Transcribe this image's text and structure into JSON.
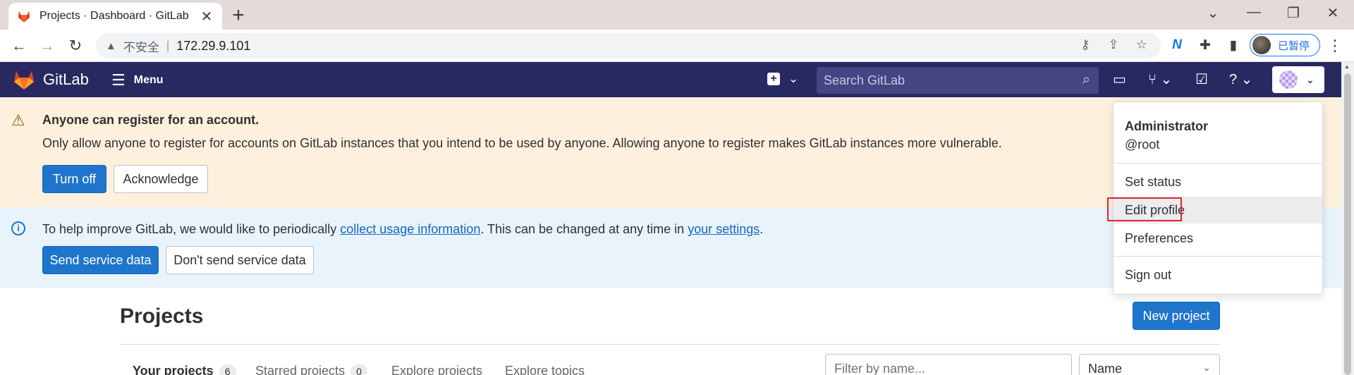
{
  "browser": {
    "tab_title": "Projects · Dashboard · GitLab",
    "insecure_label": "不安全",
    "separator": "|",
    "url": "172.29.9.101",
    "profile_label": "已暂停"
  },
  "header": {
    "brand": "GitLab",
    "menu_label": "Menu",
    "search_placeholder": "Search GitLab",
    "bg_color": "#292961"
  },
  "warning_banner": {
    "title": "Anyone can register for an account.",
    "body": "Only allow anyone to register for accounts on GitLab instances that you intend to be used by anyone. Allowing anyone to register makes GitLab instances more vulnerable.",
    "primary_label": "Turn off",
    "secondary_label": "Acknowledge"
  },
  "info_banner": {
    "text_before": "To help improve GitLab, we would like to periodically ",
    "link1": "collect usage information",
    "text_middle": ". This can be changed at any time in ",
    "link2": "your settings",
    "text_after": ".",
    "primary_label": "Send service data",
    "secondary_label": "Don't send service data"
  },
  "page": {
    "title": "Projects",
    "new_project_label": "New project",
    "tabs": [
      {
        "label": "Your projects",
        "count": "6"
      },
      {
        "label": "Starred projects",
        "count": "0"
      },
      {
        "label": "Explore projects"
      },
      {
        "label": "Explore topics"
      }
    ],
    "filter_placeholder": "Filter by name...",
    "sort_value": "Name"
  },
  "user_menu": {
    "name": "Administrator",
    "handle": "@root",
    "items": [
      "Set status",
      "Edit profile",
      "Preferences",
      "Sign out"
    ],
    "highlighted": "Edit profile"
  }
}
